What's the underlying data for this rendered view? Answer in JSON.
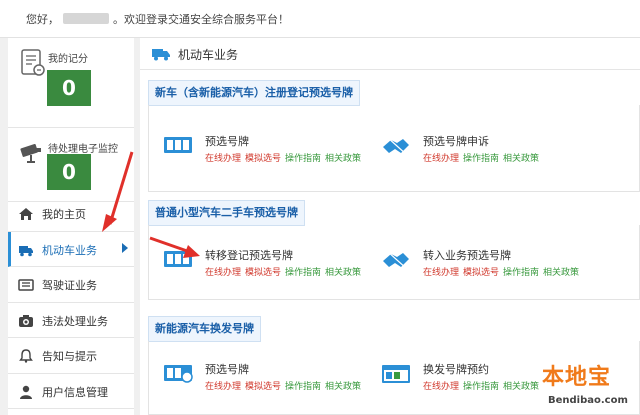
{
  "header": {
    "greeting_prefix": "您好，",
    "greeting_suffix": "。欢迎登录交通安全综合服务平台！"
  },
  "sidebar": {
    "points": {
      "label": "我的记分",
      "count": "0"
    },
    "tickets": {
      "label": "待处理电子监控",
      "count": "0"
    },
    "nav": [
      {
        "label": "我的主页",
        "icon": "home-icon"
      },
      {
        "label": "机动车业务",
        "icon": "truck-icon",
        "active": true
      },
      {
        "label": "驾驶证业务",
        "icon": "id-card-icon"
      },
      {
        "label": "违法处理业务",
        "icon": "camera-icon"
      },
      {
        "label": "告知与提示",
        "icon": "bell-icon"
      },
      {
        "label": "用户信息管理",
        "icon": "user-icon"
      }
    ]
  },
  "main": {
    "title": "机动车业务",
    "sections": [
      {
        "title": "新车（含新能源汽车）注册登记预选号牌",
        "services": [
          {
            "name": "预选号牌",
            "links": [
              "在线办理",
              "模拟选号",
              "操作指南",
              "相关政策"
            ]
          },
          {
            "name": "预选号牌申诉",
            "links": [
              "在线办理",
              "操作指南",
              "相关政策"
            ]
          }
        ]
      },
      {
        "title": "普通小型汽车二手车预选号牌",
        "services": [
          {
            "name": "转移登记预选号牌",
            "links": [
              "在线办理",
              "模拟选号",
              "操作指南",
              "相关政策"
            ]
          },
          {
            "name": "转入业务预选号牌",
            "links": [
              "在线办理",
              "模拟选号",
              "操作指南",
              "相关政策"
            ]
          }
        ]
      },
      {
        "title": "新能源汽车换发号牌",
        "services": [
          {
            "name": "预选号牌",
            "links": [
              "在线办理",
              "模拟选号",
              "操作指南",
              "相关政策"
            ]
          },
          {
            "name": "换发号牌预约",
            "links": [
              "在线办理",
              "操作指南",
              "相关政策"
            ]
          }
        ]
      }
    ]
  },
  "watermark": {
    "title": "本地宝",
    "site": "Bendibao.com"
  },
  "colors": {
    "accent": "#2b8fd6",
    "count_bg": "#3a8a3f",
    "link_red": "#d13a2e",
    "link_green": "#3a9a3f",
    "arrow": "#e0302a"
  }
}
